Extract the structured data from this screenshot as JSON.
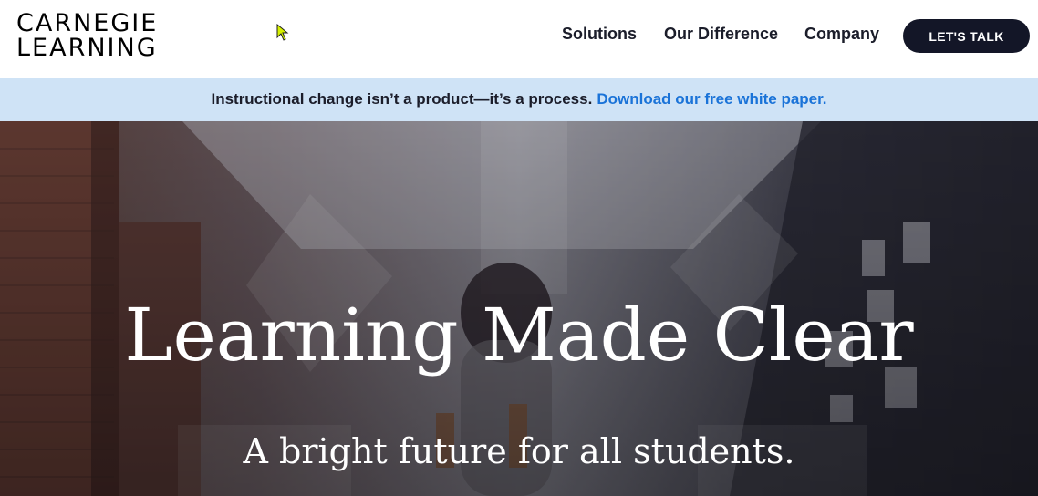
{
  "header": {
    "logo_line1": "CARNEGIE",
    "logo_line2": "LEARNING",
    "nav": [
      "Solutions",
      "Our Difference",
      "Company"
    ],
    "cta_label": "LET'S TALK"
  },
  "announcement": {
    "text": "Instructional change isn’t a product—it’s a process.",
    "link_text": "Download our free white paper."
  },
  "hero": {
    "title": "Learning Made Clear",
    "subtitle": "A bright future for all students."
  },
  "icons": {
    "cursor": "mouse-pointer-icon"
  },
  "colors": {
    "nav_text": "#1b1d2a",
    "cta_bg": "#131627",
    "announcement_bg": "#cfe3f6",
    "link": "#1a73d8"
  }
}
